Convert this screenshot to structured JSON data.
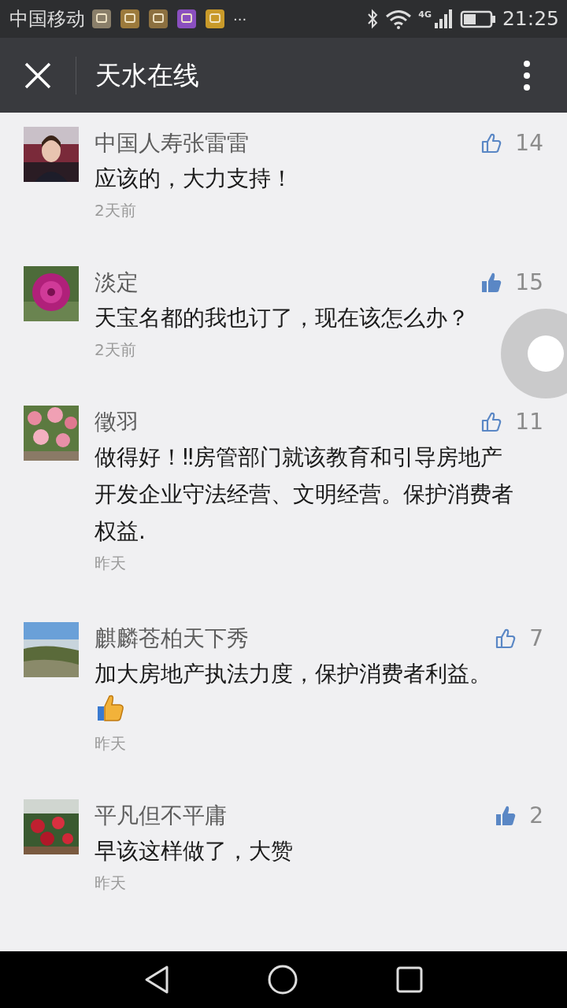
{
  "status_bar": {
    "carrier": "中国移动",
    "more": "···",
    "network": "4G",
    "time": "21:25"
  },
  "toolbar": {
    "title": "天水在线"
  },
  "comments": [
    {
      "name": "中国人寿张雷雷",
      "liked": false,
      "likes": "14",
      "text": "应该的，大力支持！",
      "emoji": false,
      "time": "2天前"
    },
    {
      "name": "淡定",
      "liked": true,
      "likes": "15",
      "text": "天宝名都的我也订了，现在该怎么办？",
      "emoji": false,
      "time": "2天前"
    },
    {
      "name": "徵羽",
      "liked": false,
      "likes": "11",
      "text": "做得好！‼房管部门就该教育和引导房地产开发企业守法经营、文明经营。保护消费者权益.",
      "emoji": false,
      "time": "昨天"
    },
    {
      "name": "麒麟苍柏天下秀",
      "liked": false,
      "likes": "7",
      "text": "加大房地产执法力度，保护消费者利益。",
      "emoji": true,
      "time": "昨天"
    },
    {
      "name": "平凡但不平庸",
      "liked": true,
      "likes": "2",
      "text": "早该这样做了，大赞",
      "emoji": false,
      "time": "昨天"
    }
  ]
}
